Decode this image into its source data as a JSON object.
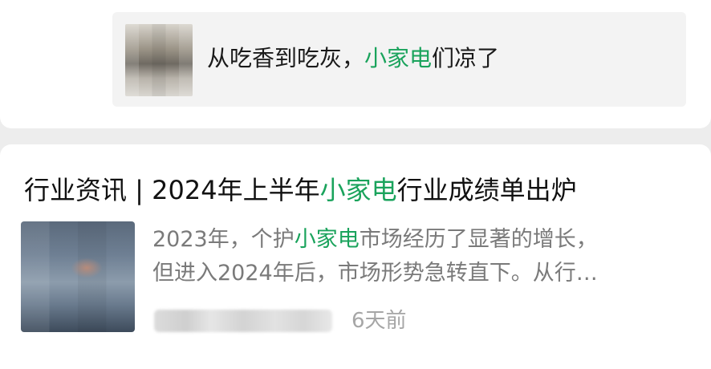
{
  "linked_article": {
    "title_before": "从吃香到吃灰，",
    "title_highlight": "小家电",
    "title_after": "们凉了"
  },
  "article": {
    "title_before": "行业资讯 | 2024年上半年",
    "title_highlight": "小家电",
    "title_after": "行业成绩单出炉",
    "summary_line1_before": "2023年，个护",
    "summary_line1_highlight": "小家电",
    "summary_line1_after": "市场经历了显著的增长，",
    "summary_line2": "但进入2024年后，市场形势急转直下。从行…",
    "time": "6天前"
  },
  "colors": {
    "highlight": "#1aa35c",
    "background": "#ededed",
    "card": "#ffffff",
    "secondary_text": "#7a7a7a"
  }
}
